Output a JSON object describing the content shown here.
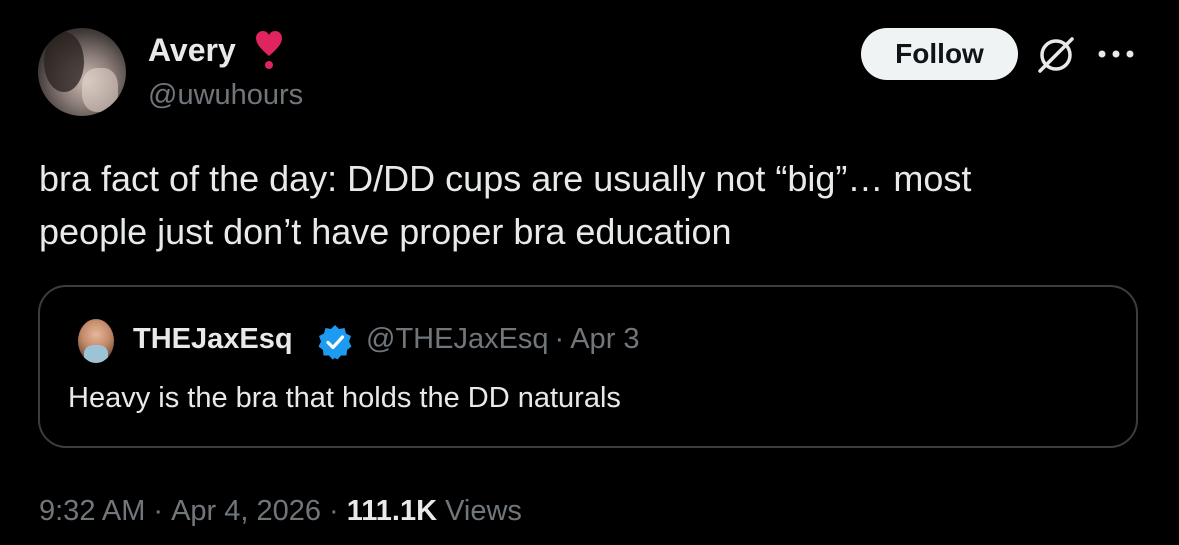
{
  "author": {
    "name": "Avery",
    "handle": "@uwuhours"
  },
  "header": {
    "follow_label": "Follow"
  },
  "tweet": {
    "text": "bra fact of the day: D/DD cups are usually not “big”… most\npeople just don’t have proper bra education"
  },
  "quote": {
    "name": "THEJaxEsq",
    "handle": "@THEJaxEsq",
    "separator": "·",
    "date": "Apr 3",
    "text": "Heavy is the bra that holds the DD naturals"
  },
  "footer": {
    "time": "9:32 AM",
    "separator": "·",
    "date": "Apr 4, 2026",
    "views_count": "111.1K",
    "views_label": "Views"
  },
  "colors": {
    "background": "#000000",
    "text_primary": "#e7e9ea",
    "text_secondary": "#71767b",
    "border": "#3a3e42",
    "follow_button_bg": "#eff3f4",
    "verified_blue": "#1d9bf0",
    "heart_red": "#e0245e"
  },
  "icons": {
    "heart": "heart-exclamation-icon",
    "verified": "verified-badge-icon",
    "grok": "grok-icon",
    "more": "more-options-icon"
  }
}
